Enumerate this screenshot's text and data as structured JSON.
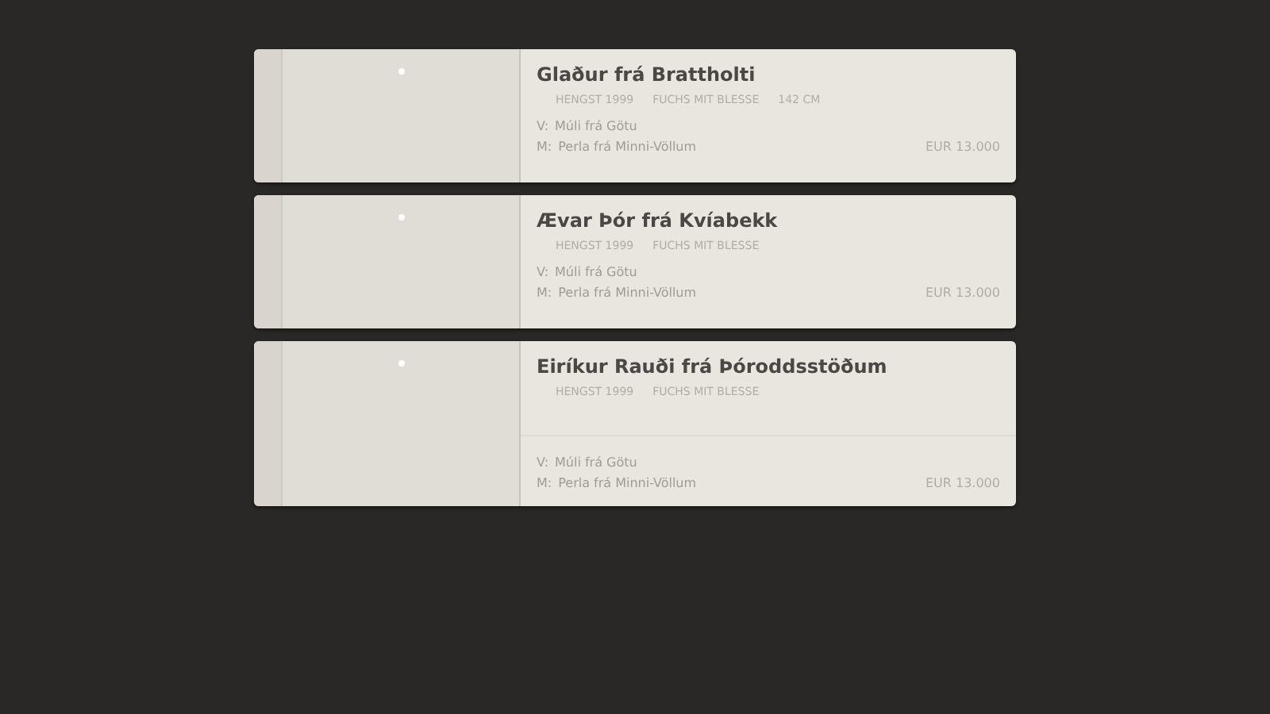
{
  "horses": [
    {
      "name": "Glaður frá Brattholti",
      "tags": [
        "HENGST 1999",
        "FUCHS MIT BLESSE",
        "142 CM"
      ],
      "sire_label": "V:",
      "sire": "Múli frá Götu",
      "dam_label": "M:",
      "dam": "Perla frá Minni-Völlum",
      "price": "EUR 13.000",
      "expanded": false
    },
    {
      "name": "Ævar Þór frá Kvíabekk",
      "tags": [
        "HENGST 1999",
        "FUCHS MIT BLESSE"
      ],
      "sire_label": "V:",
      "sire": "Múli frá Götu",
      "dam_label": "M:",
      "dam": "Perla frá Minni-Völlum",
      "price": "EUR 13.000",
      "expanded": false
    },
    {
      "name": "Eiríkur Rauði frá Þóroddsstöðum",
      "tags": [
        "HENGST 1999",
        "FUCHS MIT BLESSE"
      ],
      "sire_label": "V:",
      "sire": "Múli frá Götu",
      "dam_label": "M:",
      "dam": "Perla frá Minni-Völlum",
      "price": "EUR 13.000",
      "expanded": true
    }
  ]
}
